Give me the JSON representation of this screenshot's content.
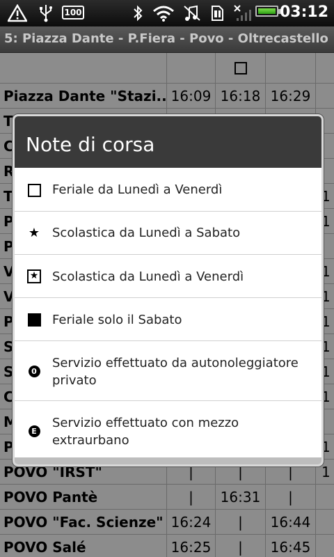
{
  "status_bar": {
    "time": "03:12",
    "battery_badge": "100",
    "icons": [
      "warning-icon",
      "usb-icon",
      "battery-100-badge-icon",
      "bluetooth-icon",
      "wifi-icon",
      "music-off-icon",
      "sim-icon",
      "no-signal-icon",
      "battery-icon"
    ]
  },
  "title": "5: Piazza Dante - P.Fiera - Povo - Oltrecastello",
  "table": {
    "header_symbol": "□",
    "rows": [
      {
        "name": "Piazza Dante \"Stazi..",
        "times": [
          "16:09",
          "16:18",
          "16:29"
        ]
      },
      {
        "name": "T",
        "times": [
          "",
          "",
          ""
        ]
      },
      {
        "name": "C",
        "times": [
          "",
          "",
          ""
        ]
      },
      {
        "name": "R",
        "times": [
          "",
          "",
          ""
        ]
      },
      {
        "name": "T",
        "times": [
          "",
          "",
          ""
        ]
      },
      {
        "name": "P",
        "times": [
          "",
          "",
          ""
        ]
      },
      {
        "name": "P",
        "times": [
          "",
          "",
          ""
        ]
      },
      {
        "name": "V",
        "times": [
          "",
          "",
          ""
        ]
      },
      {
        "name": "V",
        "times": [
          "",
          "",
          ""
        ]
      },
      {
        "name": "P",
        "times": [
          "",
          "",
          ""
        ]
      },
      {
        "name": "S",
        "times": [
          "",
          "",
          ""
        ]
      },
      {
        "name": "S",
        "times": [
          "",
          "",
          ""
        ]
      },
      {
        "name": "C",
        "times": [
          "",
          "",
          ""
        ]
      },
      {
        "name": "M",
        "times": [
          "",
          "",
          ""
        ]
      },
      {
        "name": "P",
        "times": [
          "",
          "",
          ""
        ]
      },
      {
        "name": "POVO \"IRST\"",
        "times": [
          "|",
          "|",
          "|"
        ]
      },
      {
        "name": "POVO Pantè",
        "times": [
          "|",
          "16:31",
          "|"
        ]
      },
      {
        "name": "POVO \"Fac. Scienze\"",
        "times": [
          "16:24",
          "|",
          "16:44"
        ]
      },
      {
        "name": "POVO Salé",
        "times": [
          "16:25",
          "|",
          "16:45"
        ]
      }
    ],
    "right_edge": [
      "",
      "",
      "",
      "",
      "1",
      "1",
      "",
      "1",
      "1",
      "1",
      "1",
      "1",
      "1",
      "",
      "1",
      "1",
      "",
      "",
      ""
    ]
  },
  "dialog": {
    "title": "Note di corsa",
    "options": [
      {
        "icon": "empty-square-icon",
        "label": "Feriale da Lunedì a Venerdì"
      },
      {
        "icon": "star-icon",
        "label": "Scolastica da Lunedì a Sabato"
      },
      {
        "icon": "boxed-star-icon",
        "label": "Scolastica da Lunedì a Venerdì"
      },
      {
        "icon": "filled-square-icon",
        "label": "Feriale solo il Sabato"
      },
      {
        "icon": "circled-zero-icon",
        "label": "Servizio effettuato da autonoleggiatore privato"
      },
      {
        "icon": "circled-e-icon",
        "label": "Servizio effettuato con mezzo extraurbano"
      }
    ]
  }
}
